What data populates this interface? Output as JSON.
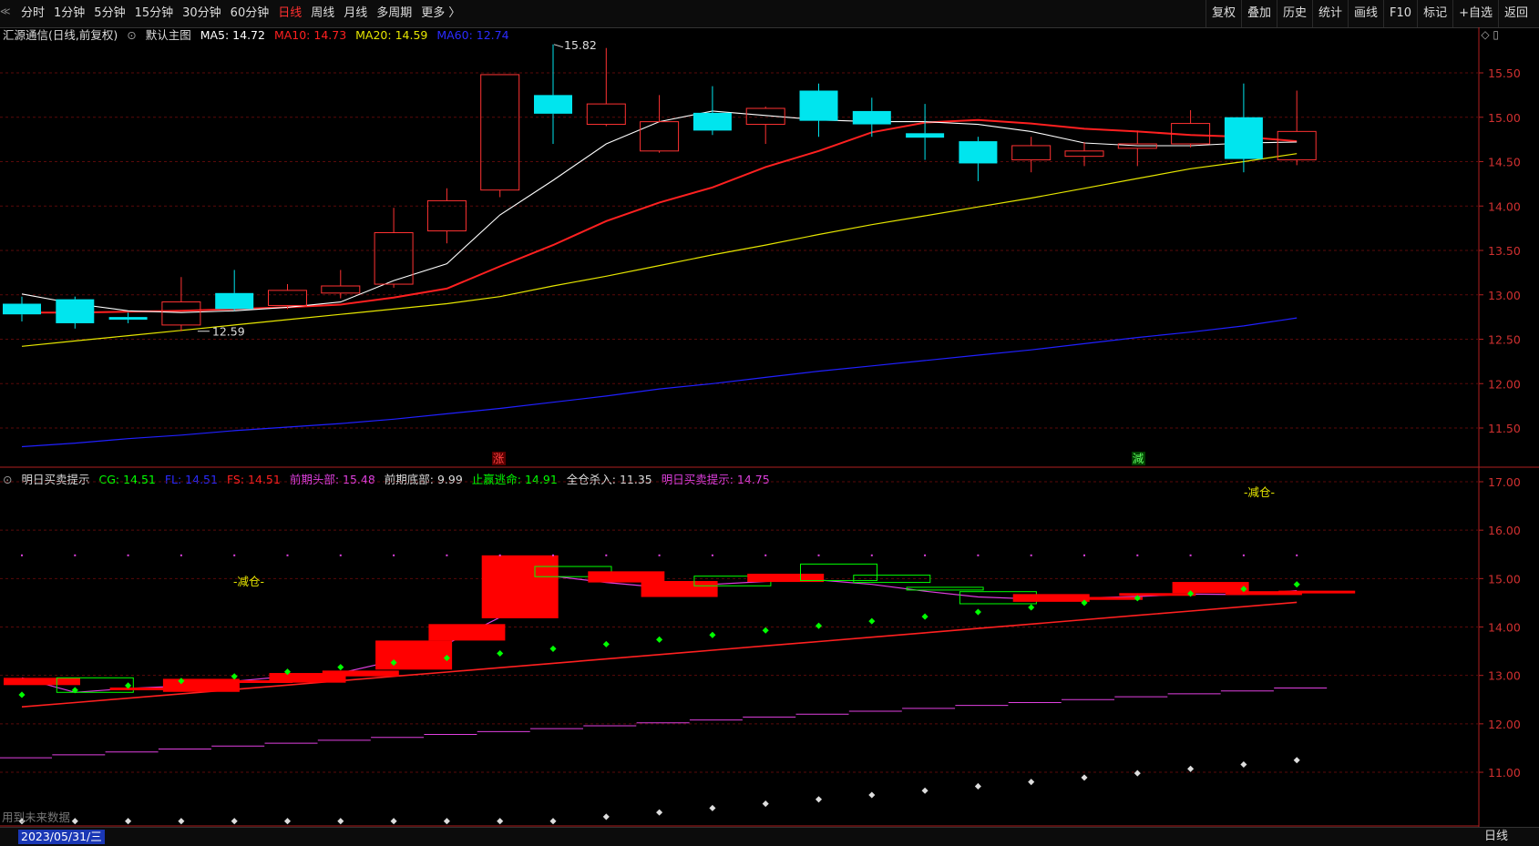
{
  "toolbar": {
    "periods": [
      "分时",
      "1分钟",
      "5分钟",
      "15分钟",
      "30分钟",
      "60分钟",
      "日线",
      "周线",
      "月线",
      "多周期",
      "更多 〉"
    ],
    "active_period": "日线",
    "actions": [
      "复权",
      "叠加",
      "历史",
      "统计",
      "画线",
      "F10",
      "标记",
      "+自选",
      "返回"
    ]
  },
  "main_panel": {
    "title": "汇源通信(日线,前复权)",
    "template": "默认主图",
    "ma5": "MA5: 14.72",
    "ma10": "MA10: 14.73",
    "ma20": "MA20: 14.59",
    "ma60": "MA60: 12.74",
    "high_label": "15.82",
    "low_label": "12.59",
    "marker_up": "涨",
    "marker_down": "減",
    "y_ticks": [
      "15.50",
      "15.00",
      "14.50",
      "14.00",
      "13.50",
      "13.00",
      "12.50",
      "12.00",
      "11.50"
    ]
  },
  "sub_panel": {
    "title": "明日买卖提示",
    "cg": "CG: 14.51",
    "fl": "FL: 14.51",
    "fs": "FS: 14.51",
    "prev_top": "前期头部: 15.48",
    "prev_bottom": "前期底部: 9.99",
    "stop_profit": "止赢逃命: 14.91",
    "full_kill": "全仓杀入: 11.35",
    "tomorrow_tip": "明日买卖提示: 14.75",
    "note_left": "-减仓-",
    "note_right": "-减仓-",
    "future_data": "用到未来数据",
    "y_ticks": [
      "17.00",
      "16.00",
      "15.00",
      "14.00",
      "13.00",
      "12.00",
      "11.00"
    ]
  },
  "bottom": {
    "date": "2023/05/31/三",
    "period": "日线"
  },
  "colors": {
    "up": "#ff3232",
    "down": "#00e5ee",
    "ma5": "#ffffff",
    "ma10": "#ff2020",
    "ma20": "#e6e600",
    "ma60": "#2020ff",
    "magenta": "#e040e0",
    "green": "#00ff00"
  },
  "chart_data": {
    "type": "candlestick",
    "candles": [
      {
        "o": 12.9,
        "c": 12.78,
        "h": 12.98,
        "l": 12.7
      },
      {
        "o": 12.95,
        "c": 12.68,
        "h": 12.98,
        "l": 12.62
      },
      {
        "o": 12.75,
        "c": 12.72,
        "h": 12.8,
        "l": 12.68
      },
      {
        "o": 12.66,
        "c": 12.92,
        "h": 13.2,
        "l": 12.59
      },
      {
        "o": 13.02,
        "c": 12.84,
        "h": 13.28,
        "l": 12.82
      },
      {
        "o": 12.88,
        "c": 13.05,
        "h": 13.12,
        "l": 12.84
      },
      {
        "o": 13.02,
        "c": 13.1,
        "h": 13.28,
        "l": 12.96
      },
      {
        "o": 13.12,
        "c": 13.7,
        "h": 13.98,
        "l": 13.08
      },
      {
        "o": 13.72,
        "c": 14.06,
        "h": 14.2,
        "l": 13.58
      },
      {
        "o": 14.18,
        "c": 15.48,
        "h": 15.48,
        "l": 14.1
      },
      {
        "o": 15.25,
        "c": 15.04,
        "h": 15.82,
        "l": 14.7
      },
      {
        "o": 14.92,
        "c": 15.15,
        "h": 15.78,
        "l": 14.9
      },
      {
        "o": 14.62,
        "c": 14.95,
        "h": 15.25,
        "l": 14.6
      },
      {
        "o": 15.05,
        "c": 14.85,
        "h": 15.35,
        "l": 14.8
      },
      {
        "o": 14.92,
        "c": 15.1,
        "h": 15.12,
        "l": 14.7
      },
      {
        "o": 15.3,
        "c": 14.96,
        "h": 15.38,
        "l": 14.78
      },
      {
        "o": 15.07,
        "c": 14.92,
        "h": 15.22,
        "l": 14.78
      },
      {
        "o": 14.82,
        "c": 14.77,
        "h": 15.15,
        "l": 14.52
      },
      {
        "o": 14.73,
        "c": 14.48,
        "h": 14.78,
        "l": 14.28
      },
      {
        "o": 14.52,
        "c": 14.68,
        "h": 14.78,
        "l": 14.38
      },
      {
        "o": 14.56,
        "c": 14.62,
        "h": 14.72,
        "l": 14.45
      },
      {
        "o": 14.65,
        "c": 14.7,
        "h": 14.85,
        "l": 14.45
      },
      {
        "o": 14.7,
        "c": 14.93,
        "h": 15.08,
        "l": 14.66
      },
      {
        "o": 15.0,
        "c": 14.53,
        "h": 15.38,
        "l": 14.38
      },
      {
        "o": 14.52,
        "c": 14.84,
        "h": 15.3,
        "l": 14.46
      }
    ],
    "ma5": [
      13.01,
      12.9,
      12.82,
      12.8,
      12.82,
      12.86,
      12.92,
      13.16,
      13.35,
      13.9,
      14.29,
      14.7,
      14.95,
      15.07,
      15.02,
      14.97,
      14.95,
      14.95,
      14.92,
      14.84,
      14.71,
      14.68,
      14.68,
      14.71,
      14.72
    ],
    "ma10": [
      12.8,
      12.8,
      12.81,
      12.82,
      12.84,
      12.86,
      12.89,
      12.97,
      13.07,
      13.32,
      13.56,
      13.83,
      14.04,
      14.21,
      14.44,
      14.62,
      14.83,
      14.94,
      14.97,
      14.93,
      14.87,
      14.84,
      14.8,
      14.78,
      14.73
    ],
    "ma20": [
      12.42,
      12.48,
      12.54,
      12.6,
      12.66,
      12.72,
      12.78,
      12.84,
      12.9,
      12.98,
      13.1,
      13.21,
      13.33,
      13.45,
      13.56,
      13.68,
      13.79,
      13.89,
      13.99,
      14.09,
      14.2,
      14.31,
      14.42,
      14.5,
      14.59
    ],
    "ma60": [
      11.29,
      11.33,
      11.38,
      11.42,
      11.47,
      11.51,
      11.55,
      11.6,
      11.66,
      11.72,
      11.79,
      11.86,
      11.94,
      12.0,
      12.07,
      12.14,
      12.2,
      12.26,
      12.32,
      12.38,
      12.45,
      12.52,
      12.58,
      12.65,
      12.74
    ]
  }
}
